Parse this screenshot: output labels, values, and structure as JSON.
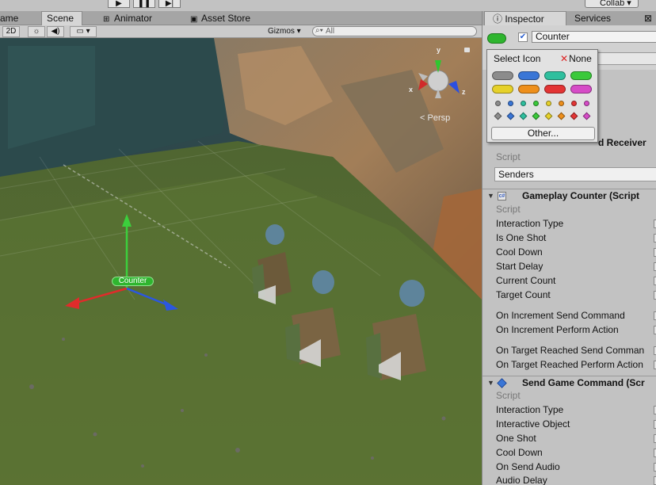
{
  "toolbar": {
    "collab_label": "Collab"
  },
  "tabs": [
    {
      "label": "ame"
    },
    {
      "label": "Scene"
    },
    {
      "label": "Animator"
    },
    {
      "label": "Asset Store"
    }
  ],
  "scene_toolbar": {
    "mode_2d": "2D",
    "gizmos_label": "Gizmos",
    "search_placeholder": "All"
  },
  "scene": {
    "projection_label": "Persp",
    "axis_y": "y",
    "axis_x": "x",
    "axis_z": "z",
    "selected_object_label": "Counter"
  },
  "inspector": {
    "tabs": [
      {
        "label": "Inspector"
      },
      {
        "label": "Services"
      }
    ],
    "object_name": "Counter",
    "object_active": true,
    "icon_popup": {
      "title": "Select Icon",
      "none_label": "None",
      "other_label": "Other...",
      "label_colors": [
        "#8c8c8c",
        "#3a76d6",
        "#2fbf9e",
        "#3ac93a",
        "#e6d12a",
        "#ee8f1b",
        "#e33434",
        "#d64cc7"
      ],
      "dot_colors": [
        "#8c8c8c",
        "#3a76d6",
        "#2fbf9e",
        "#3ac93a",
        "#e6d12a",
        "#ee8f1b",
        "#e33434",
        "#d64cc7"
      ]
    },
    "partial_header": "d Receiver",
    "receiver": {
      "script_label": "Script",
      "senders_label": "Senders"
    },
    "gameplay_counter": {
      "title": "Gameplay Counter (Script",
      "fields": [
        "Script",
        "Interaction Type",
        "Is One Shot",
        "Cool Down",
        "Start Delay",
        "Current Count",
        "Target Count",
        "On Increment Send Command",
        "On Increment Perform Action",
        "On Target Reached Send Comman",
        "On Target Reached Perform Action"
      ]
    },
    "send_game_command": {
      "title": "Send Game Command (Scr",
      "fields": [
        "Script",
        "Interaction Type",
        "Interactive Object",
        "One Shot",
        "Cool Down",
        "On Send Audio",
        "Audio Delay"
      ]
    }
  }
}
